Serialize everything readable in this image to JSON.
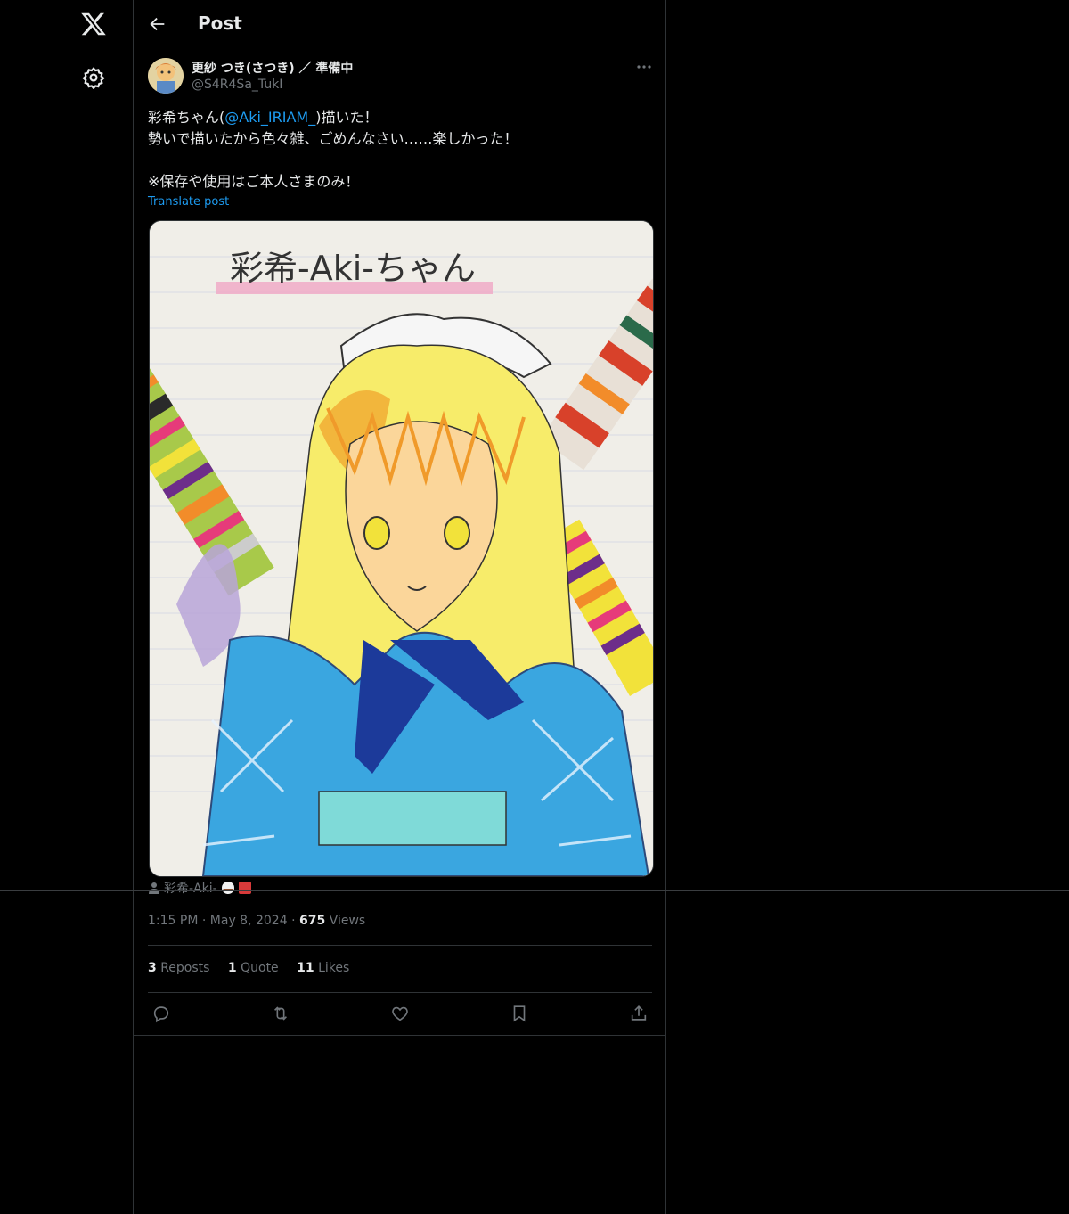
{
  "nav": {
    "logo_icon": "x-logo-icon",
    "settings_icon": "gear-icon"
  },
  "header": {
    "title": "Post",
    "back_icon": "arrow-left-icon"
  },
  "post": {
    "author_name": "更紗 つき(さつき) ／ 準備中",
    "author_handle": "@S4R4Sa_TukI",
    "text_part1": "彩希ちゃん(",
    "mention": "@Aki_IRIAM_",
    "text_part2": ")描いた！\n勢いで描いたから色々雑、ごめんなさい……楽しかった！\n\n※保存や使用はご本人さまのみ！",
    "translate_label": "Translate post",
    "media_title_handwritten": "彩希-Aki-ちゃん",
    "tagged_user": "彩希-Aki-",
    "time": "1:15 PM",
    "date": "May 8, 2024",
    "views_count": "675",
    "views_label": "Views",
    "reposts_count": "3",
    "reposts_label": "Reposts",
    "quotes_count": "1",
    "quotes_label": "Quote",
    "likes_count": "11",
    "likes_label": "Likes"
  },
  "actions": [
    "reply-icon",
    "repost-icon",
    "like-icon",
    "bookmark-icon",
    "share-icon"
  ],
  "colors": {
    "background": "#000000",
    "text": "#e7e9ea",
    "muted": "#71767b",
    "accent": "#1d9bf0",
    "border": "#2f3336"
  }
}
